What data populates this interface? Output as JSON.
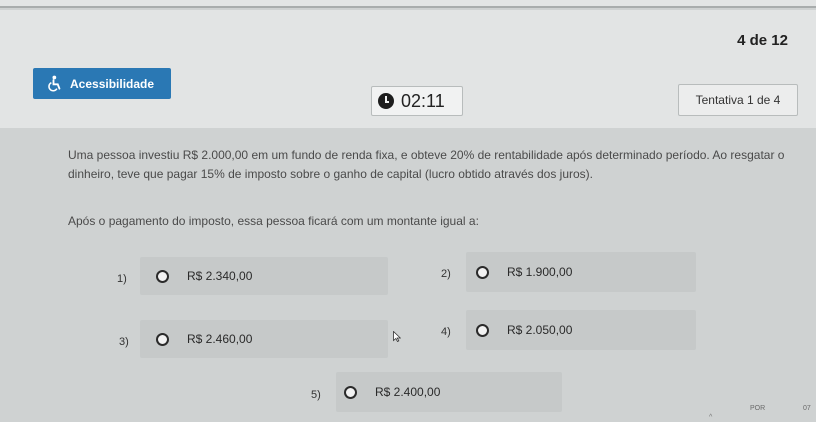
{
  "header": {
    "question_counter": "4 de 12",
    "accessibility_label": "Acessibilidade",
    "timer": "02:11",
    "attempt": "Tentativa 1 de 4"
  },
  "question": {
    "text": "Uma pessoa investiu R$ 2.000,00 em um fundo de renda fixa, e obteve 20% de rentabilidade após determinado período. Ao resgatar o dinheiro, teve que pagar 15% de imposto sobre o ganho de capital (lucro obtido através dos juros).",
    "prompt": "Após o pagamento do imposto, essa pessoa ficará com um montante igual a:"
  },
  "options": [
    {
      "number": "1)",
      "text": "R$ 2.340,00"
    },
    {
      "number": "2)",
      "text": "R$ 1.900,00"
    },
    {
      "number": "3)",
      "text": "R$ 2.460,00"
    },
    {
      "number": "4)",
      "text": "R$ 2.050,00"
    },
    {
      "number": "5)",
      "text": "R$ 2.400,00"
    }
  ],
  "taskbar": {
    "language": "POR",
    "time": "07"
  },
  "colors": {
    "accent": "#2a78b4",
    "header_bg": "#e2e4e4",
    "page_bg": "#cfd2d2"
  },
  "icons": {
    "accessibility": "accessibility-icon",
    "timer": "clock-icon",
    "cursor": "mouse-cursor-icon"
  }
}
